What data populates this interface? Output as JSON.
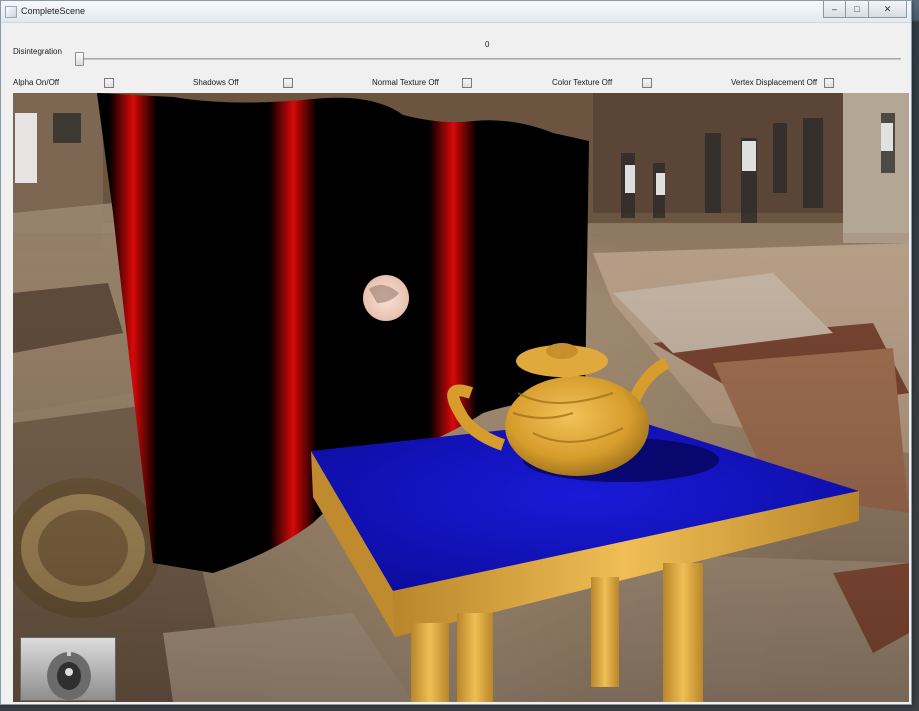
{
  "window": {
    "title": "CompleteScene"
  },
  "controls": {
    "slider": {
      "label": "Disintegration",
      "value": "0"
    },
    "checkboxes": [
      {
        "label": "Alpha On/Off",
        "checked": false
      },
      {
        "label": "Shadows Off",
        "checked": false
      },
      {
        "label": "Normal Texture Off",
        "checked": false
      },
      {
        "label": "Color Texture Off",
        "checked": false
      },
      {
        "label": "Vertex Displacement Off",
        "checked": false
      }
    ]
  },
  "icons": {
    "minimize": "minimize-icon",
    "maximize": "maximize-icon",
    "close": "close-icon"
  },
  "colors": {
    "curtain_red": "#e00000",
    "table_top": "#1010c8",
    "wood": "#d9a33a"
  }
}
